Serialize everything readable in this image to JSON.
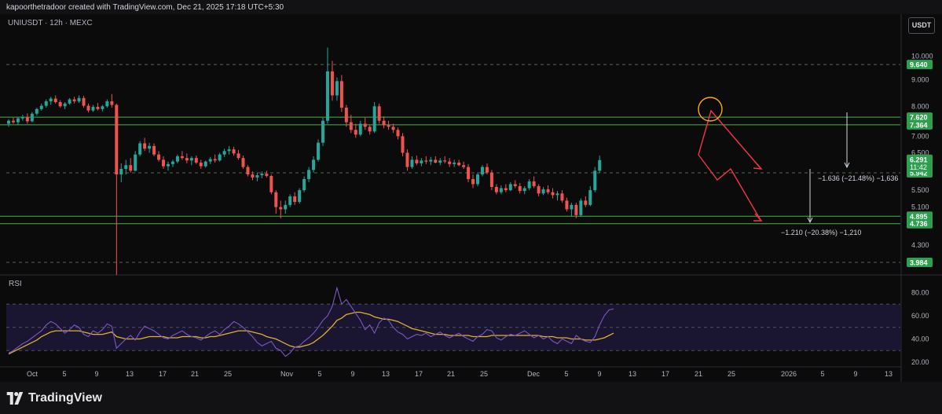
{
  "header": {
    "text": "kapoorthetradoor created with TradingView.com, Dec 21, 2025 17:18 UTC+5:30"
  },
  "symbol_line": "UNIUSDT · 12h · MEXC",
  "currency_button": "USDT",
  "rsi_label": "RSI",
  "brand": {
    "name": "TradingView",
    "logo_icon": "tradingview-logo-icon"
  },
  "colors": {
    "up": "#26a69a",
    "down": "#ef5350",
    "green_line": "#4caf50",
    "rsi_line": "#7e57c2",
    "rsi_ma": "#e0b030",
    "rsi_band": "#1a1530",
    "projection": "#f23645",
    "circle": "#f5a623",
    "label_green": "#2e9e4f",
    "label_dark": "#1f6e3d"
  },
  "chart_data": [
    {
      "type": "candlestick",
      "title": "UNIUSDT · 12h · MEXC",
      "price_axis_ticks": [
        10.0,
        9.0,
        8.0,
        7.0,
        6.5,
        5.5,
        5.1,
        4.3
      ],
      "price_axis_tick_labels": [
        "10.000",
        "9.000",
        "8.000",
        "7.000",
        "6.500",
        "5.500",
        "5.100",
        "4.300"
      ],
      "x_tick_labels": [
        "Oct",
        "5",
        "9",
        "13",
        "17",
        "21",
        "25",
        "Nov",
        "5",
        "9",
        "13",
        "17",
        "21",
        "25",
        "Dec",
        "5",
        "9",
        "13",
        "17",
        "21",
        "25",
        "2026",
        "5",
        "9",
        "13"
      ],
      "horizontal_levels": [
        {
          "value": 9.64,
          "label": "9.640",
          "style": "dashed"
        },
        {
          "value": 7.62,
          "label": "7.620",
          "style": "solid-green"
        },
        {
          "value": 7.364,
          "label": "7.364",
          "style": "solid-green"
        },
        {
          "value": 5.942,
          "label": "5.942",
          "style": "dashed"
        },
        {
          "value": 4.895,
          "label": "4.895",
          "style": "solid-green"
        },
        {
          "value": 4.736,
          "label": "4.736",
          "style": "solid-green"
        },
        {
          "value": 3.984,
          "label": "3.984",
          "style": "dashed"
        }
      ],
      "current_price": {
        "value": 6.291,
        "label": "6.291",
        "countdown": "11:42"
      },
      "candles_ohlc": [
        [
          7.4,
          7.55,
          7.3,
          7.5
        ],
        [
          7.5,
          7.6,
          7.4,
          7.45
        ],
        [
          7.45,
          7.62,
          7.35,
          7.58
        ],
        [
          7.58,
          7.7,
          7.5,
          7.62
        ],
        [
          7.62,
          7.75,
          7.4,
          7.48
        ],
        [
          7.48,
          7.8,
          7.45,
          7.74
        ],
        [
          7.74,
          7.95,
          7.68,
          7.9
        ],
        [
          7.9,
          8.1,
          7.85,
          8.02
        ],
        [
          8.02,
          8.25,
          7.95,
          8.18
        ],
        [
          8.18,
          8.35,
          8.05,
          8.28
        ],
        [
          8.28,
          8.4,
          8.1,
          8.15
        ],
        [
          8.15,
          8.22,
          7.95,
          8.0
        ],
        [
          8.0,
          8.15,
          7.9,
          8.1
        ],
        [
          8.1,
          8.3,
          8.05,
          8.25
        ],
        [
          8.25,
          8.35,
          8.1,
          8.18
        ],
        [
          8.18,
          8.4,
          8.12,
          8.3
        ],
        [
          8.3,
          8.38,
          7.95,
          8.02
        ],
        [
          8.02,
          8.1,
          7.78,
          7.85
        ],
        [
          7.85,
          8.05,
          7.8,
          7.98
        ],
        [
          7.98,
          8.12,
          7.85,
          7.9
        ],
        [
          7.9,
          8.05,
          7.82,
          8.0
        ],
        [
          8.0,
          8.25,
          7.95,
          8.18
        ],
        [
          8.18,
          8.45,
          7.95,
          8.05
        ],
        [
          8.05,
          8.1,
          3.6,
          5.9
        ],
        [
          5.9,
          6.2,
          5.7,
          6.05
        ],
        [
          6.05,
          6.3,
          5.9,
          6.15
        ],
        [
          6.15,
          6.35,
          5.95,
          6.0
        ],
        [
          6.0,
          6.55,
          5.98,
          6.45
        ],
        [
          6.45,
          6.85,
          6.4,
          6.78
        ],
        [
          6.78,
          6.95,
          6.55,
          6.62
        ],
        [
          6.62,
          6.8,
          6.5,
          6.7
        ],
        [
          6.7,
          6.78,
          6.4,
          6.45
        ],
        [
          6.45,
          6.55,
          6.25,
          6.3
        ],
        [
          6.3,
          6.4,
          6.05,
          6.12
        ],
        [
          6.12,
          6.25,
          6.0,
          6.18
        ],
        [
          6.18,
          6.3,
          6.1,
          6.25
        ],
        [
          6.25,
          6.45,
          6.2,
          6.4
        ],
        [
          6.4,
          6.55,
          6.3,
          6.35
        ],
        [
          6.35,
          6.48,
          6.2,
          6.28
        ],
        [
          6.28,
          6.4,
          6.15,
          6.35
        ],
        [
          6.35,
          6.42,
          6.18,
          6.22
        ],
        [
          6.22,
          6.3,
          6.05,
          6.12
        ],
        [
          6.12,
          6.28,
          6.08,
          6.25
        ],
        [
          6.25,
          6.38,
          6.18,
          6.32
        ],
        [
          6.32,
          6.45,
          6.22,
          6.28
        ],
        [
          6.28,
          6.5,
          6.25,
          6.45
        ],
        [
          6.45,
          6.62,
          6.38,
          6.55
        ],
        [
          6.55,
          6.7,
          6.45,
          6.6
        ],
        [
          6.6,
          6.68,
          6.42,
          6.48
        ],
        [
          6.48,
          6.58,
          6.3,
          6.35
        ],
        [
          6.35,
          6.42,
          6.05,
          6.1
        ],
        [
          6.1,
          6.15,
          5.85,
          5.9
        ],
        [
          5.9,
          5.98,
          5.75,
          5.82
        ],
        [
          5.82,
          5.95,
          5.72,
          5.88
        ],
        [
          5.88,
          5.98,
          5.8,
          5.92
        ],
        [
          5.92,
          6.0,
          5.82,
          5.86
        ],
        [
          5.86,
          5.9,
          5.4,
          5.45
        ],
        [
          5.45,
          5.5,
          4.95,
          5.1
        ],
        [
          5.1,
          5.25,
          4.85,
          5.05
        ],
        [
          5.05,
          5.25,
          4.95,
          5.15
        ],
        [
          5.15,
          5.4,
          5.1,
          5.35
        ],
        [
          5.35,
          5.45,
          5.15,
          5.22
        ],
        [
          5.22,
          5.55,
          5.18,
          5.5
        ],
        [
          5.5,
          5.85,
          5.45,
          5.78
        ],
        [
          5.78,
          6.1,
          5.7,
          6.02
        ],
        [
          6.02,
          6.4,
          5.95,
          6.3
        ],
        [
          6.3,
          6.9,
          6.25,
          6.8
        ],
        [
          6.8,
          7.6,
          6.7,
          7.5
        ],
        [
          7.5,
          10.4,
          7.4,
          9.35
        ],
        [
          9.35,
          9.8,
          8.2,
          8.4
        ],
        [
          8.4,
          9.1,
          8.2,
          8.95
        ],
        [
          8.95,
          9.2,
          7.8,
          7.95
        ],
        [
          7.95,
          8.05,
          7.3,
          7.45
        ],
        [
          7.45,
          7.7,
          7.1,
          7.2
        ],
        [
          7.2,
          7.4,
          6.95,
          7.05
        ],
        [
          7.05,
          7.5,
          7.0,
          7.4
        ],
        [
          7.4,
          7.6,
          7.2,
          7.3
        ],
        [
          7.3,
          7.35,
          7.05,
          7.15
        ],
        [
          7.15,
          8.15,
          7.1,
          8.0
        ],
        [
          8.0,
          8.1,
          7.4,
          7.5
        ],
        [
          7.5,
          7.65,
          7.25,
          7.35
        ],
        [
          7.35,
          7.5,
          7.2,
          7.3
        ],
        [
          7.3,
          7.4,
          7.1,
          7.2
        ],
        [
          7.2,
          7.28,
          6.9,
          7.0
        ],
        [
          7.0,
          7.1,
          6.4,
          6.5
        ],
        [
          6.5,
          6.6,
          6.0,
          6.1
        ],
        [
          6.1,
          6.4,
          6.05,
          6.3
        ],
        [
          6.3,
          6.42,
          6.15,
          6.2
        ],
        [
          6.2,
          6.35,
          6.12,
          6.28
        ],
        [
          6.28,
          6.4,
          6.18,
          6.25
        ],
        [
          6.25,
          6.38,
          6.15,
          6.3
        ],
        [
          6.3,
          6.4,
          6.2,
          6.22
        ],
        [
          6.22,
          6.35,
          6.15,
          6.28
        ],
        [
          6.28,
          6.4,
          6.2,
          6.25
        ],
        [
          6.25,
          6.35,
          6.1,
          6.18
        ],
        [
          6.18,
          6.3,
          6.1,
          6.22
        ],
        [
          6.22,
          6.3,
          6.12,
          6.15
        ],
        [
          6.15,
          6.25,
          6.05,
          6.1
        ],
        [
          6.1,
          6.18,
          5.7,
          5.78
        ],
        [
          5.78,
          5.9,
          5.55,
          5.65
        ],
        [
          5.65,
          5.95,
          5.6,
          5.9
        ],
        [
          5.9,
          6.15,
          5.85,
          6.1
        ],
        [
          6.1,
          6.2,
          5.9,
          5.95
        ],
        [
          5.95,
          6.02,
          5.5,
          5.58
        ],
        [
          5.58,
          5.65,
          5.4,
          5.45
        ],
        [
          5.45,
          5.62,
          5.4,
          5.55
        ],
        [
          5.55,
          5.65,
          5.45,
          5.5
        ],
        [
          5.5,
          5.7,
          5.48,
          5.65
        ],
        [
          5.65,
          5.75,
          5.55,
          5.6
        ],
        [
          5.6,
          5.68,
          5.42,
          5.48
        ],
        [
          5.48,
          5.6,
          5.4,
          5.55
        ],
        [
          5.55,
          5.78,
          5.5,
          5.72
        ],
        [
          5.72,
          5.85,
          5.55,
          5.6
        ],
        [
          5.6,
          5.65,
          5.35,
          5.42
        ],
        [
          5.42,
          5.58,
          5.38,
          5.52
        ],
        [
          5.52,
          5.62,
          5.4,
          5.45
        ],
        [
          5.45,
          5.55,
          5.3,
          5.38
        ],
        [
          5.38,
          5.48,
          5.25,
          5.42
        ],
        [
          5.42,
          5.5,
          5.2,
          5.25
        ],
        [
          5.25,
          5.32,
          5.0,
          5.05
        ],
        [
          5.05,
          5.2,
          4.9,
          5.15
        ],
        [
          5.15,
          5.2,
          4.85,
          4.92
        ],
        [
          4.92,
          5.3,
          4.88,
          5.25
        ],
        [
          5.25,
          5.35,
          5.1,
          5.15
        ],
        [
          5.15,
          5.6,
          5.12,
          5.5
        ],
        [
          5.5,
          6.1,
          5.45,
          6.0
        ],
        [
          6.0,
          6.42,
          5.95,
          6.29
        ]
      ]
    },
    {
      "type": "line",
      "title": "RSI",
      "ylim": [
        20,
        85
      ],
      "y_tick_labels": [
        "80.00",
        "60.00",
        "40.00",
        "20.00"
      ],
      "bands": [
        70,
        50,
        30
      ],
      "series": [
        {
          "values": [
            28,
            30,
            33,
            36,
            38,
            41,
            44,
            47,
            52,
            55,
            53,
            49,
            45,
            48,
            52,
            50,
            44,
            42,
            47,
            45,
            48,
            53,
            51,
            32,
            36,
            40,
            43,
            39,
            46,
            51,
            49,
            47,
            44,
            41,
            40,
            43,
            45,
            47,
            44,
            42,
            41,
            39,
            42,
            45,
            47,
            44,
            48,
            51,
            55,
            53,
            50,
            46,
            42,
            37,
            34,
            36,
            38,
            32,
            30,
            25,
            28,
            33,
            34,
            38,
            41,
            45,
            50,
            56,
            60,
            68,
            84,
            70,
            74,
            68,
            62,
            56,
            48,
            52,
            45,
            54,
            58,
            56,
            50,
            46,
            44,
            40,
            42,
            44,
            43,
            45,
            42,
            44,
            46,
            43,
            41,
            43,
            45,
            42,
            40,
            38,
            42,
            44,
            48,
            47,
            41,
            39,
            42,
            44,
            43,
            45,
            47,
            44,
            41,
            43,
            40,
            42,
            38,
            36,
            40,
            38,
            36,
            43,
            40,
            38,
            37,
            42,
            52,
            60,
            65,
            66
          ]
        },
        {
          "values": [
            27,
            29,
            31,
            33,
            35,
            37,
            39,
            42,
            44,
            46,
            47,
            47,
            47,
            47,
            47,
            47,
            46,
            45,
            44,
            44,
            44,
            45,
            46,
            42,
            41,
            40,
            40,
            40,
            40,
            41,
            42,
            42,
            42,
            42,
            41,
            41,
            41,
            42,
            42,
            42,
            42,
            41,
            41,
            42,
            42,
            43,
            44,
            45,
            46,
            47,
            47,
            47,
            46,
            45,
            44,
            42,
            41,
            40,
            38,
            36,
            34,
            33,
            33,
            34,
            35,
            37,
            40,
            43,
            47,
            51,
            56,
            58,
            61,
            62,
            63,
            63,
            62,
            61,
            59,
            58,
            57,
            57,
            56,
            55,
            53,
            51,
            49,
            48,
            47,
            46,
            45,
            44,
            44,
            44,
            43,
            43,
            43,
            43,
            43,
            42,
            42,
            42,
            42,
            43,
            43,
            43,
            43,
            43,
            43,
            43,
            43,
            43,
            43,
            43,
            42,
            42,
            42,
            41,
            41,
            41,
            40,
            40,
            40,
            39,
            39,
            39,
            40,
            41,
            43,
            45
          ]
        }
      ]
    }
  ],
  "annotations": {
    "measure_top": "−1.636 (−21.48%) −1,636",
    "measure_bottom": "−1.210 (−20.38%) −1,210"
  }
}
